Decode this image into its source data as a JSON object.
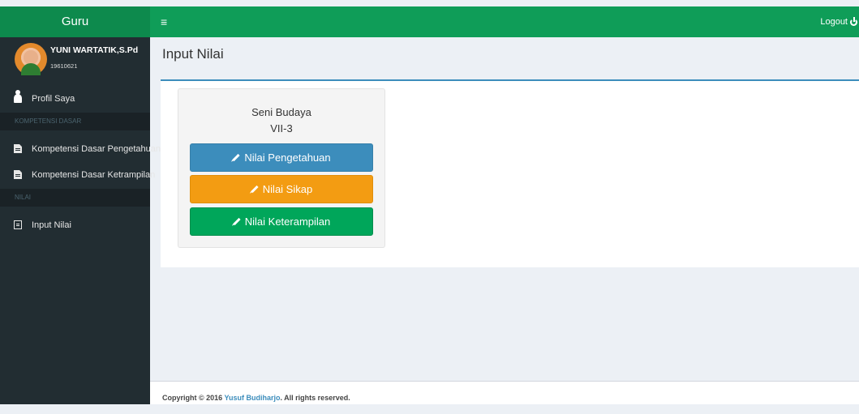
{
  "topbar": {
    "brand": "Guru",
    "menu_icon": "hamburger-icon",
    "logout_label": "Logout",
    "logout_icon": "power-icon"
  },
  "user": {
    "name": "YUNI WARTATIK,S.Pd",
    "id": "19610621"
  },
  "sidebar": {
    "items": [
      {
        "label": "Profil Saya",
        "icon": "user-icon"
      },
      {
        "header": "KOMPETENSI DASAR"
      },
      {
        "label": "Kompetensi Dasar Pengetahuan",
        "icon": "file-icon"
      },
      {
        "label": "Kompetensi Dasar Ketrampilan",
        "icon": "file-icon"
      },
      {
        "header": "NILAI"
      },
      {
        "label": "Input Nilai",
        "icon": "input-icon"
      }
    ]
  },
  "page": {
    "title": "Input Nilai"
  },
  "card": {
    "subject": "Seni Budaya",
    "class": "VII-3",
    "buttons": [
      {
        "label": "Nilai Pengetahuan",
        "color": "#3c8dbc"
      },
      {
        "label": "Nilai Sikap",
        "color": "#f39c12"
      },
      {
        "label": "Nilai Keterampilan",
        "color": "#00a65a"
      }
    ]
  },
  "footer": {
    "prefix": "Copyright © 2016",
    "author": "Yusuf Budiharjo",
    "suffix": ". All rights reserved."
  },
  "colors": {
    "topbar": "#0f9d58",
    "sidebar": "#222d32",
    "accent": "#3c8dbc"
  }
}
